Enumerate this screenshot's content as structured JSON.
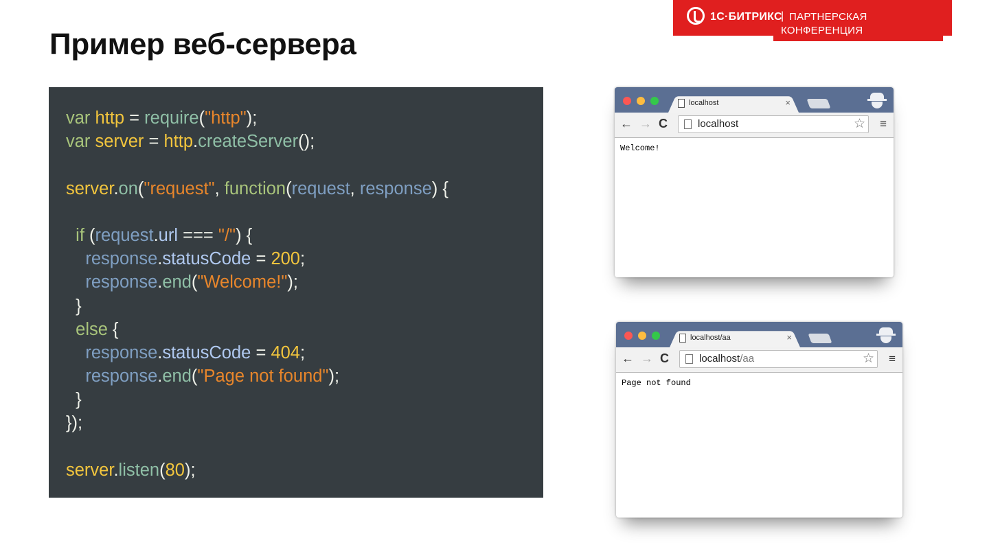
{
  "slide": {
    "title": "Пример веб-сервера"
  },
  "brand": {
    "name": "1С·БИТРИКС",
    "separator": "|",
    "line1": "ПАРТНЕРСКАЯ",
    "line2": "КОНФЕРЕНЦИЯ",
    "color": "#e01f1f"
  },
  "code": {
    "background": "#363d41",
    "lines": [
      "var http = require(\"http\");",
      "var server = http.createServer();",
      "",
      "server.on(\"request\", function(request, response) {",
      "",
      "  if (request.url === \"/\") {",
      "    response.statusCode = 200;",
      "    response.end(\"Welcome!\");",
      "  }",
      "  else {",
      "    response.statusCode = 404;",
      "    response.end(\"Page not found\");",
      "  }",
      "});",
      "",
      "server.listen(80);"
    ]
  },
  "browsers": [
    {
      "tab_title": "localhost",
      "tab_close": "×",
      "url": "localhost",
      "url_dim": "",
      "body_text": "Welcome!"
    },
    {
      "tab_title": "localhost/aa",
      "tab_close": "×",
      "url": "localhost",
      "url_dim": "/aa",
      "body_text": "Page not found"
    }
  ],
  "toolbar": {
    "back": "←",
    "forward": "→",
    "reload": "C",
    "star": "☆",
    "menu": "≡"
  },
  "icons": {
    "back": "back-arrow-icon",
    "forward": "forward-arrow-icon",
    "reload": "reload-icon",
    "star": "bookmark-star-icon",
    "menu": "hamburger-menu-icon",
    "doc": "document-icon",
    "incognito": "incognito-icon"
  }
}
